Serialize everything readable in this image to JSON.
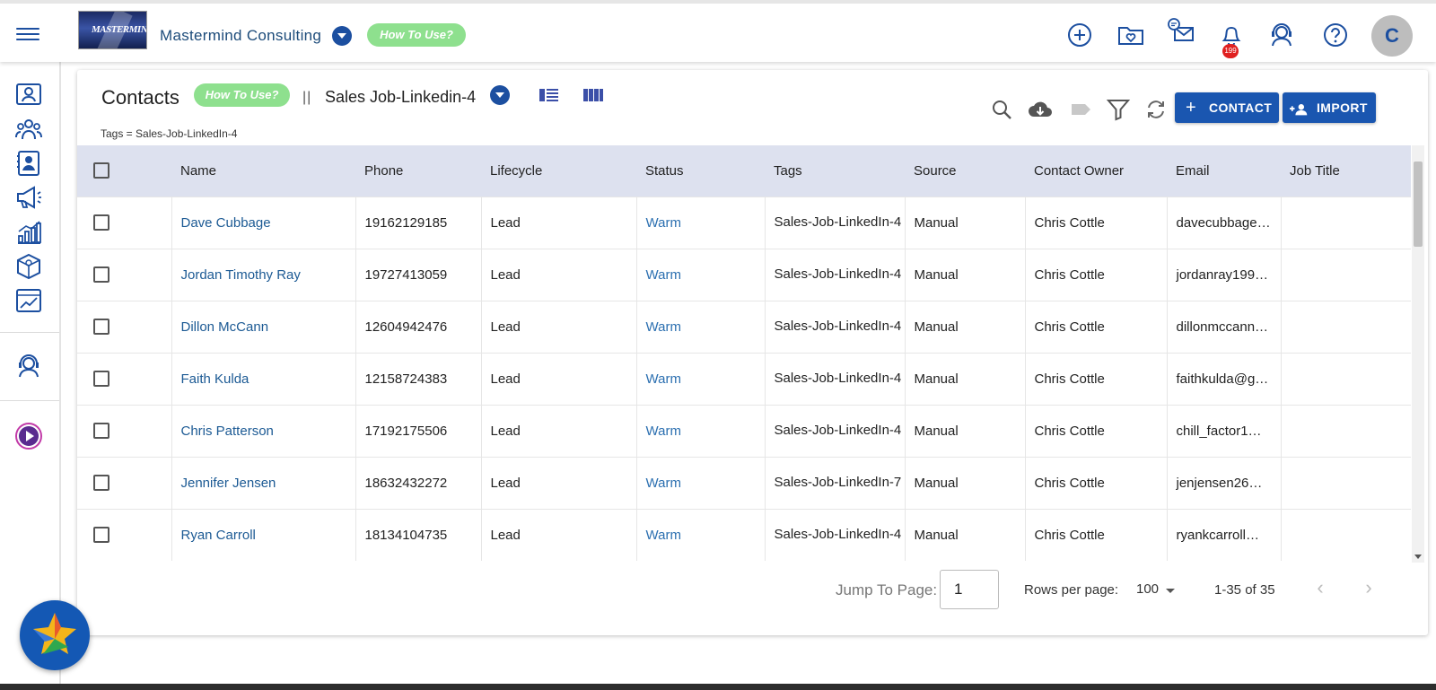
{
  "header": {
    "company": "Mastermind Consulting",
    "howto": "How To Use?",
    "notification_count": "199",
    "avatar_letter": "C",
    "logo_text": "MASTERMIND",
    "icons": [
      "add-circle-icon",
      "folder-heart-icon",
      "messages-icon",
      "bell-icon",
      "support-agent-icon",
      "help-icon"
    ]
  },
  "sidebar": {
    "icons": [
      "contact-card-icon",
      "users-group-icon",
      "contacts-book-icon",
      "megaphone-icon",
      "bar-chart-icon",
      "box-settings-icon",
      "line-chart-icon",
      "support-agent-icon",
      "play-video-icon"
    ]
  },
  "page": {
    "title": "Contacts",
    "howto": "How To Use?",
    "separator": "||",
    "list_name": "Sales Job-Linkedin-4",
    "tag_filter": "Tags = Sales-Job-LinkedIn-4",
    "contact_button": "CONTACT",
    "import_button": "IMPORT"
  },
  "table": {
    "columns": [
      "Name",
      "Phone",
      "Lifecycle",
      "Status",
      "Tags",
      "Source",
      "Contact Owner",
      "Email",
      "Job Title"
    ],
    "rows": [
      {
        "name": "Dave Cubbage",
        "phone": "19162129185",
        "lifecycle": "Lead",
        "status": "Warm",
        "tags": "Sales-Job-LinkedIn-4",
        "source": "Manual",
        "owner": "Chris Cottle",
        "email": "davecubbage…",
        "job": ""
      },
      {
        "name": "Jordan Timothy Ray",
        "phone": "19727413059",
        "lifecycle": "Lead",
        "status": "Warm",
        "tags": "Sales-Job-LinkedIn-4",
        "source": "Manual",
        "owner": "Chris Cottle",
        "email": "jordanray199…",
        "job": ""
      },
      {
        "name": "Dillon McCann",
        "phone": "12604942476",
        "lifecycle": "Lead",
        "status": "Warm",
        "tags": "Sales-Job-LinkedIn-4",
        "source": "Manual",
        "owner": "Chris Cottle",
        "email": "dillonmccann…",
        "job": ""
      },
      {
        "name": "Faith Kulda",
        "phone": "12158724383",
        "lifecycle": "Lead",
        "status": "Warm",
        "tags": "Sales-Job-LinkedIn-4",
        "source": "Manual",
        "owner": "Chris Cottle",
        "email": "faithkulda@g…",
        "job": ""
      },
      {
        "name": "Chris Patterson",
        "phone": "17192175506",
        "lifecycle": "Lead",
        "status": "Warm",
        "tags": "Sales-Job-LinkedIn-4",
        "source": "Manual",
        "owner": "Chris Cottle",
        "email": "chill_factor1…",
        "job": ""
      },
      {
        "name": "Jennifer Jensen",
        "phone": "18632432272",
        "lifecycle": "Lead",
        "status": "Warm",
        "tags": "Sales-Job-LinkedIn-7",
        "source": "Manual",
        "owner": "Chris Cottle",
        "email": "jenjensen26…",
        "job": ""
      },
      {
        "name": "Ryan Carroll",
        "phone": "18134104735",
        "lifecycle": "Lead",
        "status": "Warm",
        "tags": "Sales-Job-LinkedIn-4",
        "source": "Manual",
        "owner": "Chris Cottle",
        "email": "ryankcarroll…",
        "job": ""
      }
    ]
  },
  "pagination": {
    "jump_label": "Jump To Page:",
    "jump_value": "1",
    "rows_label": "Rows per page:",
    "rows_value": "100",
    "range": "1-35 of 35"
  },
  "colors": {
    "brand_blue": "#1a56b0",
    "header_row": "#dde1ef",
    "howto_green": "#8ee08e",
    "link_blue": "#1c5a94"
  }
}
